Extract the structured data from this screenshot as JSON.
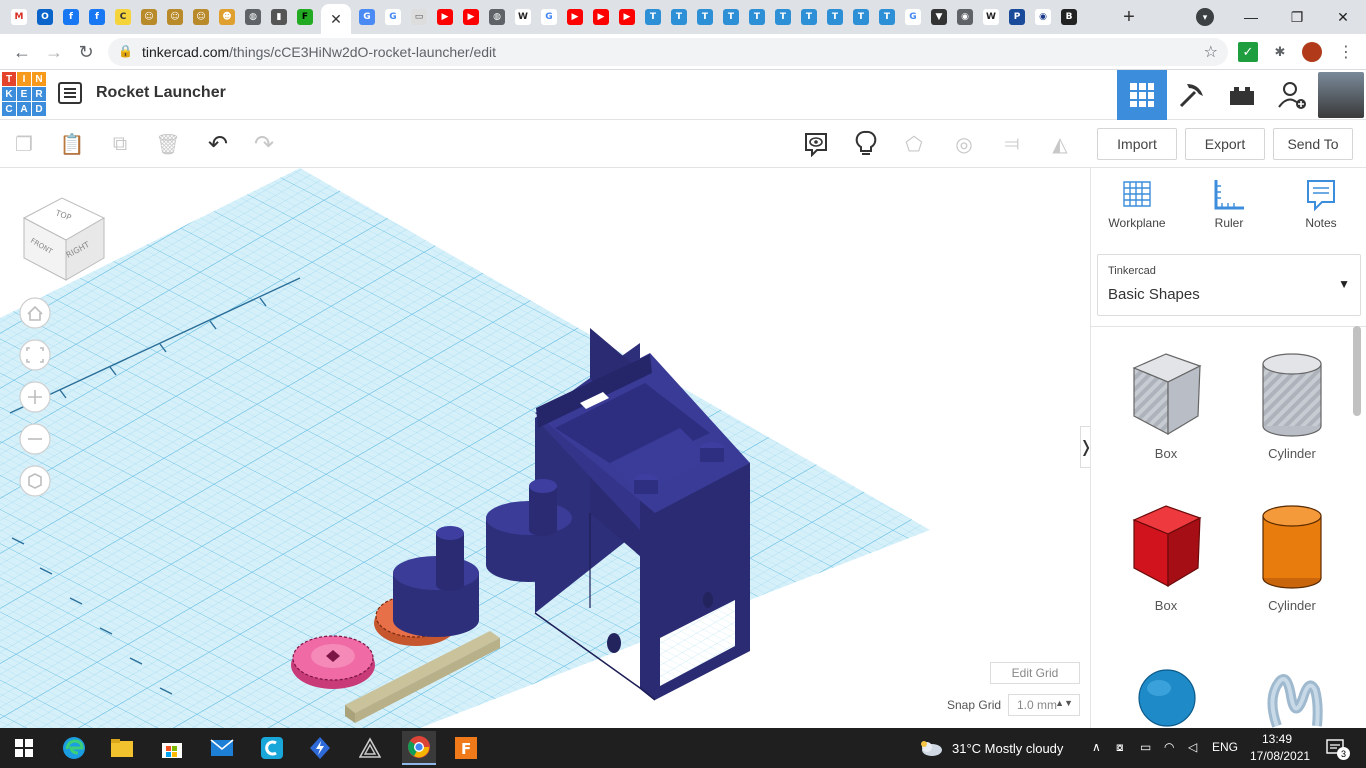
{
  "browser": {
    "tab_close_glyph": "✕",
    "new_tab_glyph": "+",
    "url_host": "tinkercad.com",
    "url_path": "/things/cCE3HiNw2dO-rocket-launcher/edit",
    "tab_favicons": [
      {
        "name": "gmail-icon",
        "char": "M",
        "color": "#ffffff",
        "fg": "#d93025"
      },
      {
        "name": "outlook-icon",
        "char": "O",
        "color": "#0a64c9",
        "fg": "#ffffff"
      },
      {
        "name": "facebook-icon",
        "char": "f",
        "color": "#1877f2",
        "fg": "#ffffff"
      },
      {
        "name": "facebook-icon",
        "char": "f",
        "color": "#1877f2",
        "fg": "#ffffff"
      },
      {
        "name": "c-icon",
        "char": "C",
        "color": "#f5d33a",
        "fg": "#333333"
      },
      {
        "name": "bot-icon",
        "char": "☺",
        "color": "#b88a2a",
        "fg": "#ffffff"
      },
      {
        "name": "bot-icon",
        "char": "☺",
        "color": "#b88a2a",
        "fg": "#ffffff"
      },
      {
        "name": "bot-icon",
        "char": "☺",
        "color": "#b88a2a",
        "fg": "#ffffff"
      },
      {
        "name": "person-icon",
        "char": "☻",
        "color": "#e0a030",
        "fg": "#ffffff"
      },
      {
        "name": "globe-icon",
        "char": "◍",
        "color": "#5f6368",
        "fg": "#ffffff"
      },
      {
        "name": "slide-icon",
        "char": "▮",
        "color": "#555555",
        "fg": "#ffffff"
      },
      {
        "name": "f-icon",
        "char": "F",
        "color": "#22aa22",
        "fg": "#000000"
      }
    ],
    "tab_favicons_right": [
      {
        "name": "translate-icon",
        "char": "G",
        "color": "#4a8af4",
        "fg": "#ffffff"
      },
      {
        "name": "google-icon",
        "char": "G",
        "color": "#ffffff",
        "fg": "#4285f4"
      },
      {
        "name": "page-icon",
        "char": "▭",
        "color": "#dddddd",
        "fg": "#555555"
      },
      {
        "name": "youtube-icon",
        "char": "▶",
        "color": "#ff0000",
        "fg": "#ffffff"
      },
      {
        "name": "youtube-icon",
        "char": "▶",
        "color": "#ff0000",
        "fg": "#ffffff"
      },
      {
        "name": "globe-icon",
        "char": "◍",
        "color": "#5f6368",
        "fg": "#ffffff"
      },
      {
        "name": "wikipedia-icon",
        "char": "W",
        "color": "#ffffff",
        "fg": "#222222"
      },
      {
        "name": "google-icon",
        "char": "G",
        "color": "#ffffff",
        "fg": "#4285f4"
      },
      {
        "name": "youtube-icon",
        "char": "▶",
        "color": "#ff0000",
        "fg": "#ffffff"
      },
      {
        "name": "youtube-icon",
        "char": "▶",
        "color": "#ff0000",
        "fg": "#ffffff"
      },
      {
        "name": "youtube-icon",
        "char": "▶",
        "color": "#ff0000",
        "fg": "#ffffff"
      },
      {
        "name": "t-icon",
        "char": "T",
        "color": "#2d8fd5",
        "fg": "#ffffff"
      },
      {
        "name": "t-icon",
        "char": "T",
        "color": "#2d8fd5",
        "fg": "#ffffff"
      },
      {
        "name": "t-icon",
        "char": "T",
        "color": "#2d8fd5",
        "fg": "#ffffff"
      },
      {
        "name": "t-icon",
        "char": "T",
        "color": "#2d8fd5",
        "fg": "#ffffff"
      },
      {
        "name": "t-icon",
        "char": "T",
        "color": "#2d8fd5",
        "fg": "#ffffff"
      },
      {
        "name": "t-icon",
        "char": "T",
        "color": "#2d8fd5",
        "fg": "#ffffff"
      },
      {
        "name": "t-icon",
        "char": "T",
        "color": "#2d8fd5",
        "fg": "#ffffff"
      },
      {
        "name": "t-icon",
        "char": "T",
        "color": "#2d8fd5",
        "fg": "#ffffff"
      },
      {
        "name": "t-icon",
        "char": "T",
        "color": "#2d8fd5",
        "fg": "#ffffff"
      },
      {
        "name": "t-icon",
        "char": "T",
        "color": "#2d8fd5",
        "fg": "#ffffff"
      },
      {
        "name": "google-icon",
        "char": "G",
        "color": "#ffffff",
        "fg": "#4285f4"
      },
      {
        "name": "shield-icon",
        "char": "▼",
        "color": "#333333",
        "fg": "#ffffff"
      },
      {
        "name": "chrome-icon",
        "char": "◉",
        "color": "#5f6368",
        "fg": "#ffffff"
      },
      {
        "name": "wikipedia-icon",
        "char": "W",
        "color": "#ffffff",
        "fg": "#222222"
      },
      {
        "name": "p-icon",
        "char": "P",
        "color": "#1a4a9a",
        "fg": "#ffffff"
      },
      {
        "name": "eye-icon",
        "char": "◉",
        "color": "#ffffff",
        "fg": "#1a3a8a"
      },
      {
        "name": "bbc-icon",
        "char": "B",
        "color": "#222222",
        "fg": "#ffffff"
      }
    ]
  },
  "app": {
    "title": "Rocket Launcher",
    "logo_letters": [
      "T",
      "I",
      "N",
      "K",
      "E",
      "R",
      "C",
      "A",
      "D"
    ],
    "logo_colors": [
      "#e4442b",
      "#f79a1c",
      "#f79a1c",
      "#3c8ddc",
      "#3c8ddc",
      "#3c8ddc",
      "#3c8ddc",
      "#3c8ddc",
      "#3c8ddc"
    ]
  },
  "toolbar": {
    "import": "Import",
    "export": "Export",
    "send_to": "Send To"
  },
  "viewcube": {
    "top": "TOP",
    "front": "FRONT",
    "right": "RIGHT"
  },
  "viewport": {
    "edit_grid": "Edit Grid",
    "snap_grid_label": "Snap Grid",
    "snap_grid_value": "1.0 mm",
    "grid_color": "#bfe6f5"
  },
  "panel": {
    "tools": [
      {
        "name": "workplane-tool",
        "label": "Workplane"
      },
      {
        "name": "ruler-tool",
        "label": "Ruler"
      },
      {
        "name": "notes-tool",
        "label": "Notes"
      }
    ],
    "library_small": "Tinkercad",
    "library_main": "Basic Shapes",
    "shapes": [
      {
        "label": "Box",
        "color": "#c7cbd2"
      },
      {
        "label": "Cylinder",
        "color": "#c7cbd2"
      },
      {
        "label": "Box",
        "color": "#d0131c"
      },
      {
        "label": "Cylinder",
        "color": "#e87d0d"
      }
    ]
  },
  "taskbar": {
    "weather": "31°C  Mostly cloudy",
    "lang": "ENG",
    "time": "13:49",
    "date": "17/08/2021",
    "notif_count": "3"
  }
}
